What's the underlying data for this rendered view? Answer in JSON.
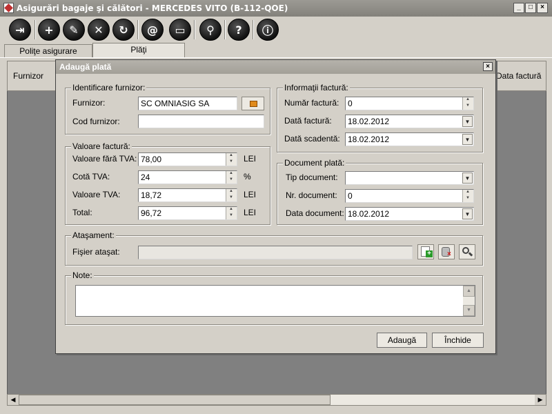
{
  "window": {
    "title": "Asigurări bagaje şi călători - MERCEDES VITO (B-112-QOE)",
    "minimize": "_",
    "maximize": "□",
    "close": "×"
  },
  "toolbar": {
    "buttons": [
      {
        "name": "exit",
        "glyph": "⇥"
      },
      {
        "name": "add",
        "glyph": "+"
      },
      {
        "name": "edit",
        "glyph": "✎"
      },
      {
        "name": "delete",
        "glyph": "✕"
      },
      {
        "name": "refresh",
        "glyph": "↻"
      },
      {
        "name": "email",
        "glyph": "@"
      },
      {
        "name": "print",
        "glyph": "▭"
      },
      {
        "name": "search",
        "glyph": "⚲"
      },
      {
        "name": "help",
        "glyph": "?"
      },
      {
        "name": "info",
        "glyph": "ⓘ"
      }
    ]
  },
  "tabs": [
    {
      "label": "Poliţe asigurare"
    },
    {
      "label": "Plăţi"
    }
  ],
  "grid": {
    "columns": [
      "Furnizor",
      "Data factură"
    ]
  },
  "dialog": {
    "title": "Adaugă plată",
    "close": "×",
    "supplier": {
      "legend": "Identificare furnizor:",
      "supplier_label": "Furnizor:",
      "supplier_value": "SC OMNIASIG SA",
      "code_label": "Cod furnizor:",
      "code_value": ""
    },
    "invoice_value": {
      "legend": "Valoare factură:",
      "net_label": "Valoare fără TVA:",
      "net_value": "78,00",
      "net_unit": "LEI",
      "vat_rate_label": "Cotă TVA:",
      "vat_rate_value": "24",
      "vat_rate_unit": "%",
      "vat_label": "Valoare TVA:",
      "vat_value": "18,72",
      "vat_unit": "LEI",
      "total_label": "Total:",
      "total_value": "96,72",
      "total_unit": "LEI"
    },
    "invoice_info": {
      "legend": "Informaţii factură:",
      "number_label": "Număr factură:",
      "number_value": "0",
      "date_label": "Dată factură:",
      "date_value": "18.02.2012",
      "due_label": "Dată scadentă:",
      "due_value": "18.02.2012"
    },
    "payment_doc": {
      "legend": "Document plată:",
      "type_label": "Tip document:",
      "type_value": "",
      "number_label": "Nr. document:",
      "number_value": "0",
      "date_label": "Data document:",
      "date_value": "18.02.2012"
    },
    "attachment": {
      "legend": "Ataşament:",
      "file_label": "Fişier ataşat:",
      "file_value": ""
    },
    "notes": {
      "legend": "Note:",
      "value": ""
    },
    "buttons": {
      "add": "Adaugă",
      "close": "Închide"
    }
  },
  "colors": {
    "window_bg": "#d4d0c8",
    "titlebar": "#8f8d87",
    "grid_bg": "#808080"
  }
}
